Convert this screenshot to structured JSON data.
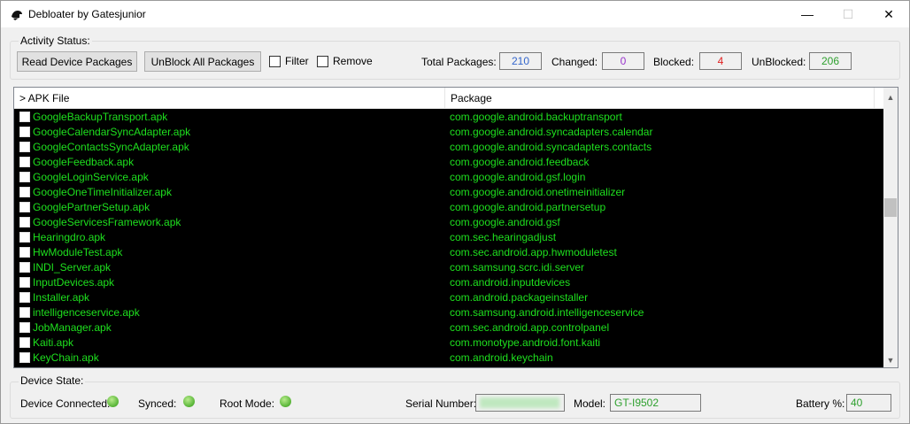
{
  "window": {
    "title": "Debloater by Gatesjunior",
    "min_glyph": "—",
    "max_glyph": "☐",
    "close_glyph": "✕"
  },
  "activity": {
    "group_label": "Activity Status:",
    "read_button": "Read Device Packages",
    "unblock_button": "UnBlock All Packages",
    "filter_label": "Filter",
    "remove_label": "Remove",
    "total_label": "Total Packages:",
    "total_value": "210",
    "changed_label": "Changed:",
    "changed_value": "0",
    "blocked_label": "Blocked:",
    "blocked_value": "4",
    "unblocked_label": "UnBlocked:",
    "unblocked_value": "206",
    "colors": {
      "total": "#3366cc",
      "changed": "#9933cc",
      "blocked": "#e02020",
      "unblocked": "#2ea02e"
    }
  },
  "list": {
    "columns": [
      "> APK File",
      "Package"
    ],
    "rows": [
      {
        "apk": "GoogleBackupTransport.apk",
        "pkg": "com.google.android.backuptransport"
      },
      {
        "apk": "GoogleCalendarSyncAdapter.apk",
        "pkg": "com.google.android.syncadapters.calendar"
      },
      {
        "apk": "GoogleContactsSyncAdapter.apk",
        "pkg": "com.google.android.syncadapters.contacts"
      },
      {
        "apk": "GoogleFeedback.apk",
        "pkg": "com.google.android.feedback"
      },
      {
        "apk": "GoogleLoginService.apk",
        "pkg": "com.google.android.gsf.login"
      },
      {
        "apk": "GoogleOneTimeInitializer.apk",
        "pkg": "com.google.android.onetimeinitializer"
      },
      {
        "apk": "GooglePartnerSetup.apk",
        "pkg": "com.google.android.partnersetup"
      },
      {
        "apk": "GoogleServicesFramework.apk",
        "pkg": "com.google.android.gsf"
      },
      {
        "apk": "Hearingdro.apk",
        "pkg": "com.sec.hearingadjust"
      },
      {
        "apk": "HwModuleTest.apk",
        "pkg": "com.sec.android.app.hwmoduletest"
      },
      {
        "apk": "INDI_Server.apk",
        "pkg": "com.samsung.scrc.idi.server"
      },
      {
        "apk": "InputDevices.apk",
        "pkg": "com.android.inputdevices"
      },
      {
        "apk": "Installer.apk",
        "pkg": "com.android.packageinstaller"
      },
      {
        "apk": "intelligenceservice.apk",
        "pkg": "com.samsung.android.intelligenceservice"
      },
      {
        "apk": "JobManager.apk",
        "pkg": "com.sec.android.app.controlpanel"
      },
      {
        "apk": "Kaiti.apk",
        "pkg": "com.monotype.android.font.kaiti"
      },
      {
        "apk": "KeyChain.apk",
        "pkg": "com.android.keychain"
      }
    ],
    "row_text_color": "#1ee01e",
    "scroll_up_glyph": "▲",
    "scroll_down_glyph": "▼"
  },
  "device": {
    "group_label": "Device State:",
    "connected_label": "Device Connected:",
    "synced_label": "Synced:",
    "root_label": "Root Mode:",
    "serial_label": "Serial Number:",
    "serial_value": "",
    "model_label": "Model:",
    "model_value": "GT-I9502",
    "battery_label": "Battery %:",
    "battery_value": "40"
  }
}
